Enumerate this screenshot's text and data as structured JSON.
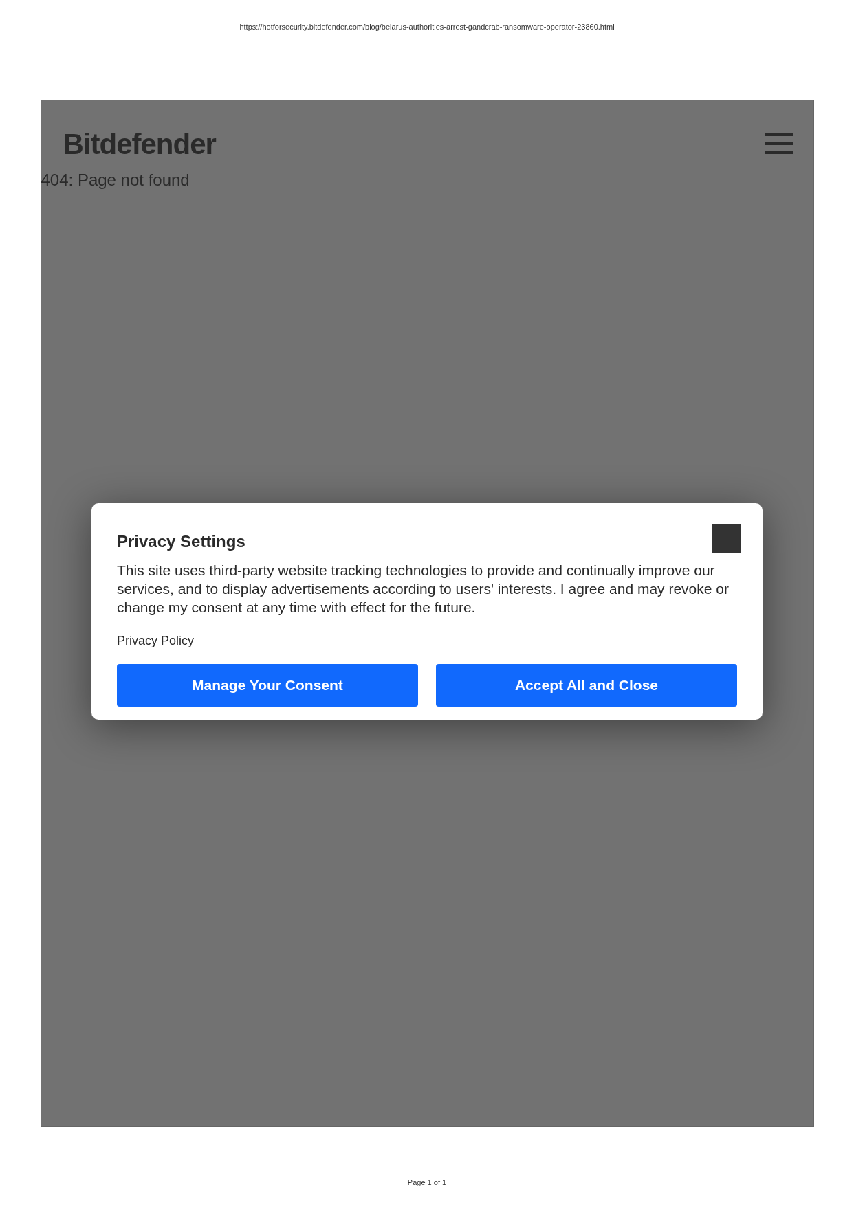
{
  "print_header": {
    "url": "https://hotforsecurity.bitdefender.com/blog/belarus-authorities-arrest-gandcrab-ransomware-operator-23860.html"
  },
  "site_header": {
    "logo": "Bitdefender"
  },
  "error_message": "404: Page not found",
  "dialog": {
    "title": "Privacy Settings",
    "body": "This site uses third-party website tracking technologies to provide and continually improve our services, and to display advertisements according to users' interests. I agree and may revoke or change my consent at any time with effect for the future.",
    "link": "Privacy Policy",
    "buttons": [
      "Manage Your Consent",
      "Accept All and Close"
    ]
  },
  "print_footer": {
    "page": "Page 1 of 1"
  }
}
